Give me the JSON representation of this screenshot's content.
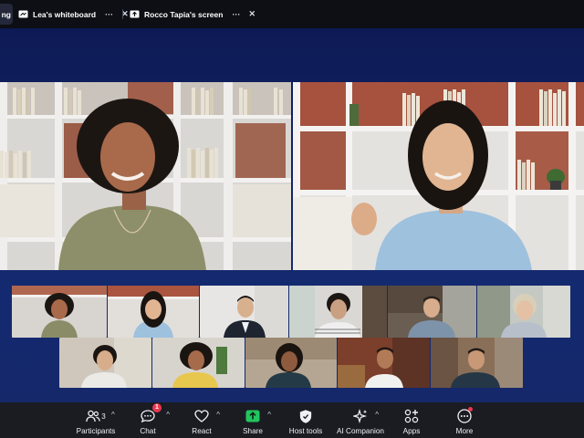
{
  "tabs": [
    {
      "label": "ng",
      "icon": "gallery-icon"
    },
    {
      "label": "Lea's whiteboard",
      "icon": "whiteboard-icon",
      "more": "···",
      "close": "✕"
    },
    {
      "label": "Rocco Tapia's screen",
      "icon": "share-screen-icon",
      "more": "···",
      "close": "✕"
    }
  ],
  "toolbar": {
    "participants": {
      "label": "Participants",
      "count": "3",
      "icon": "participants-icon"
    },
    "chat": {
      "label": "Chat",
      "badge": "1",
      "icon": "chat-icon"
    },
    "react": {
      "label": "React",
      "icon": "heart-icon"
    },
    "share": {
      "label": "Share",
      "icon": "share-icon"
    },
    "host_tools": {
      "label": "Host tools",
      "icon": "shield-icon"
    },
    "ai_companion": {
      "label": "AI Companion",
      "icon": "sparkle-icon"
    },
    "apps": {
      "label": "Apps",
      "icon": "apps-icon"
    },
    "more": {
      "label": "More",
      "icon": "more-icon"
    }
  },
  "colors": {
    "stage_bg": "#122467",
    "toolbar_bg": "#1a1c22",
    "share_green": "#22c55e",
    "badge_red": "#e8384f"
  },
  "caret": "^"
}
